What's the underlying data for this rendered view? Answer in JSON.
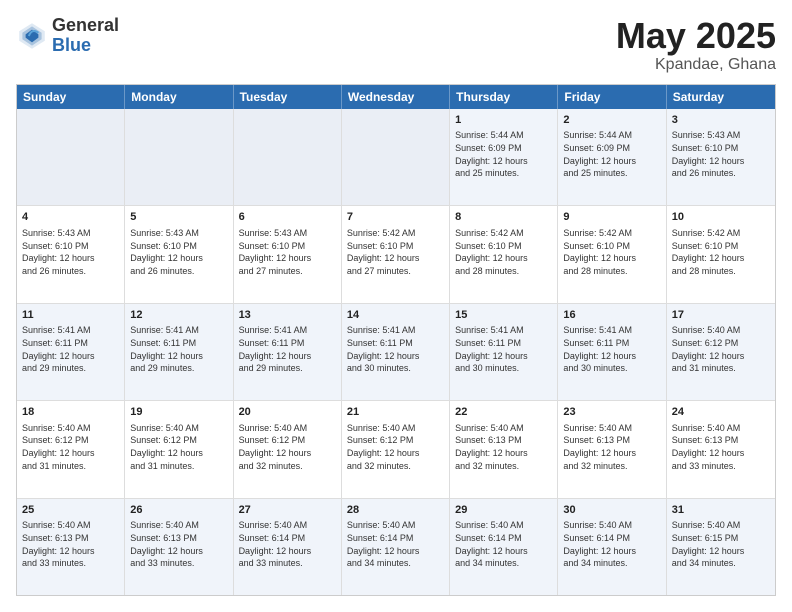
{
  "logo": {
    "general": "General",
    "blue": "Blue"
  },
  "title": {
    "month": "May 2025",
    "location": "Kpandae, Ghana"
  },
  "days_of_week": [
    "Sunday",
    "Monday",
    "Tuesday",
    "Wednesday",
    "Thursday",
    "Friday",
    "Saturday"
  ],
  "rows": [
    [
      {
        "day": "",
        "info": ""
      },
      {
        "day": "",
        "info": ""
      },
      {
        "day": "",
        "info": ""
      },
      {
        "day": "",
        "info": ""
      },
      {
        "day": "1",
        "info": "Sunrise: 5:44 AM\nSunset: 6:09 PM\nDaylight: 12 hours\nand 25 minutes."
      },
      {
        "day": "2",
        "info": "Sunrise: 5:44 AM\nSunset: 6:09 PM\nDaylight: 12 hours\nand 25 minutes."
      },
      {
        "day": "3",
        "info": "Sunrise: 5:43 AM\nSunset: 6:10 PM\nDaylight: 12 hours\nand 26 minutes."
      }
    ],
    [
      {
        "day": "4",
        "info": "Sunrise: 5:43 AM\nSunset: 6:10 PM\nDaylight: 12 hours\nand 26 minutes."
      },
      {
        "day": "5",
        "info": "Sunrise: 5:43 AM\nSunset: 6:10 PM\nDaylight: 12 hours\nand 26 minutes."
      },
      {
        "day": "6",
        "info": "Sunrise: 5:43 AM\nSunset: 6:10 PM\nDaylight: 12 hours\nand 27 minutes."
      },
      {
        "day": "7",
        "info": "Sunrise: 5:42 AM\nSunset: 6:10 PM\nDaylight: 12 hours\nand 27 minutes."
      },
      {
        "day": "8",
        "info": "Sunrise: 5:42 AM\nSunset: 6:10 PM\nDaylight: 12 hours\nand 28 minutes."
      },
      {
        "day": "9",
        "info": "Sunrise: 5:42 AM\nSunset: 6:10 PM\nDaylight: 12 hours\nand 28 minutes."
      },
      {
        "day": "10",
        "info": "Sunrise: 5:42 AM\nSunset: 6:10 PM\nDaylight: 12 hours\nand 28 minutes."
      }
    ],
    [
      {
        "day": "11",
        "info": "Sunrise: 5:41 AM\nSunset: 6:11 PM\nDaylight: 12 hours\nand 29 minutes."
      },
      {
        "day": "12",
        "info": "Sunrise: 5:41 AM\nSunset: 6:11 PM\nDaylight: 12 hours\nand 29 minutes."
      },
      {
        "day": "13",
        "info": "Sunrise: 5:41 AM\nSunset: 6:11 PM\nDaylight: 12 hours\nand 29 minutes."
      },
      {
        "day": "14",
        "info": "Sunrise: 5:41 AM\nSunset: 6:11 PM\nDaylight: 12 hours\nand 30 minutes."
      },
      {
        "day": "15",
        "info": "Sunrise: 5:41 AM\nSunset: 6:11 PM\nDaylight: 12 hours\nand 30 minutes."
      },
      {
        "day": "16",
        "info": "Sunrise: 5:41 AM\nSunset: 6:11 PM\nDaylight: 12 hours\nand 30 minutes."
      },
      {
        "day": "17",
        "info": "Sunrise: 5:40 AM\nSunset: 6:12 PM\nDaylight: 12 hours\nand 31 minutes."
      }
    ],
    [
      {
        "day": "18",
        "info": "Sunrise: 5:40 AM\nSunset: 6:12 PM\nDaylight: 12 hours\nand 31 minutes."
      },
      {
        "day": "19",
        "info": "Sunrise: 5:40 AM\nSunset: 6:12 PM\nDaylight: 12 hours\nand 31 minutes."
      },
      {
        "day": "20",
        "info": "Sunrise: 5:40 AM\nSunset: 6:12 PM\nDaylight: 12 hours\nand 32 minutes."
      },
      {
        "day": "21",
        "info": "Sunrise: 5:40 AM\nSunset: 6:12 PM\nDaylight: 12 hours\nand 32 minutes."
      },
      {
        "day": "22",
        "info": "Sunrise: 5:40 AM\nSunset: 6:13 PM\nDaylight: 12 hours\nand 32 minutes."
      },
      {
        "day": "23",
        "info": "Sunrise: 5:40 AM\nSunset: 6:13 PM\nDaylight: 12 hours\nand 32 minutes."
      },
      {
        "day": "24",
        "info": "Sunrise: 5:40 AM\nSunset: 6:13 PM\nDaylight: 12 hours\nand 33 minutes."
      }
    ],
    [
      {
        "day": "25",
        "info": "Sunrise: 5:40 AM\nSunset: 6:13 PM\nDaylight: 12 hours\nand 33 minutes."
      },
      {
        "day": "26",
        "info": "Sunrise: 5:40 AM\nSunset: 6:13 PM\nDaylight: 12 hours\nand 33 minutes."
      },
      {
        "day": "27",
        "info": "Sunrise: 5:40 AM\nSunset: 6:14 PM\nDaylight: 12 hours\nand 33 minutes."
      },
      {
        "day": "28",
        "info": "Sunrise: 5:40 AM\nSunset: 6:14 PM\nDaylight: 12 hours\nand 34 minutes."
      },
      {
        "day": "29",
        "info": "Sunrise: 5:40 AM\nSunset: 6:14 PM\nDaylight: 12 hours\nand 34 minutes."
      },
      {
        "day": "30",
        "info": "Sunrise: 5:40 AM\nSunset: 6:14 PM\nDaylight: 12 hours\nand 34 minutes."
      },
      {
        "day": "31",
        "info": "Sunrise: 5:40 AM\nSunset: 6:15 PM\nDaylight: 12 hours\nand 34 minutes."
      }
    ]
  ],
  "alt_rows": [
    0,
    2,
    4
  ]
}
